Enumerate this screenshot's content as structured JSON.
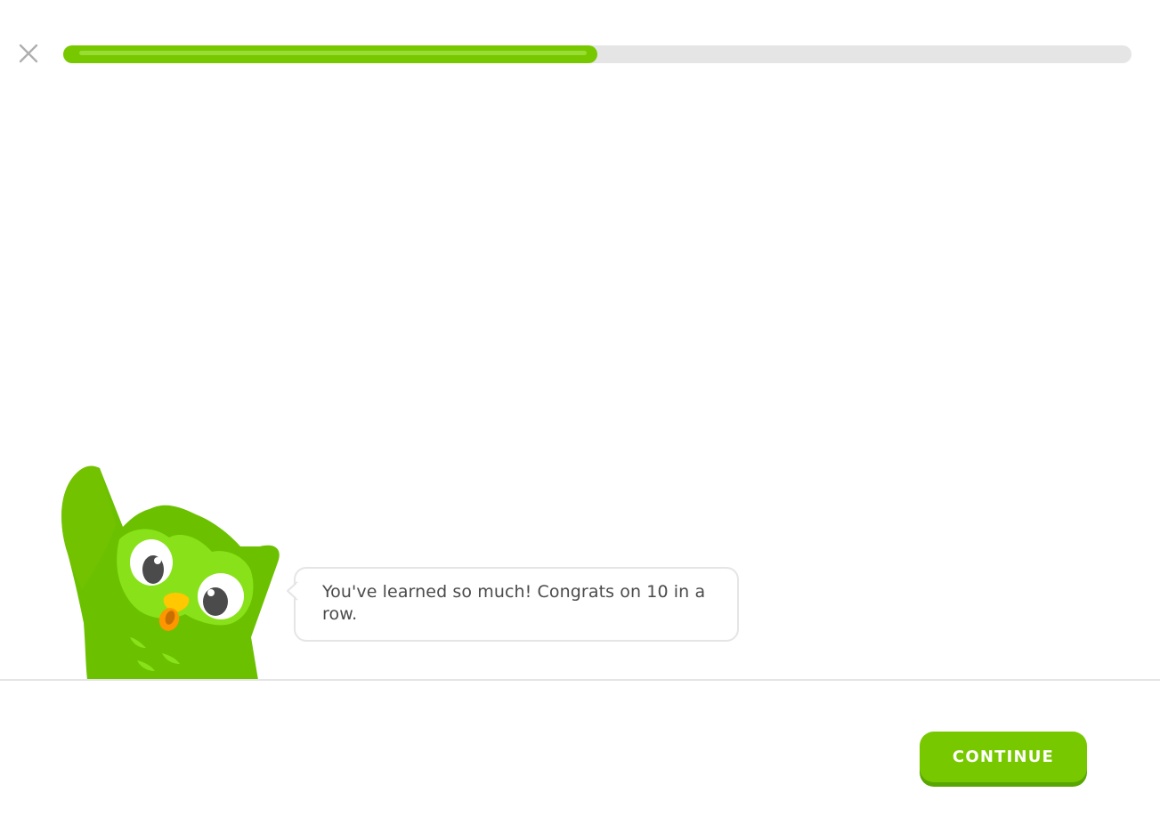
{
  "header": {
    "close_icon": "close-icon",
    "progress": {
      "value": 0.5
    }
  },
  "character": {
    "name_icon": "owl-mascot",
    "speech": "You've learned so much! Congrats on 10 in a row."
  },
  "footer": {
    "continue_label": "CONTINUE"
  },
  "colors": {
    "brand_green": "#78c800",
    "brand_green_dark": "#58a700",
    "track_gray": "#e5e5e5",
    "text": "#4b4b4b",
    "icon_gray": "#afafaf"
  }
}
